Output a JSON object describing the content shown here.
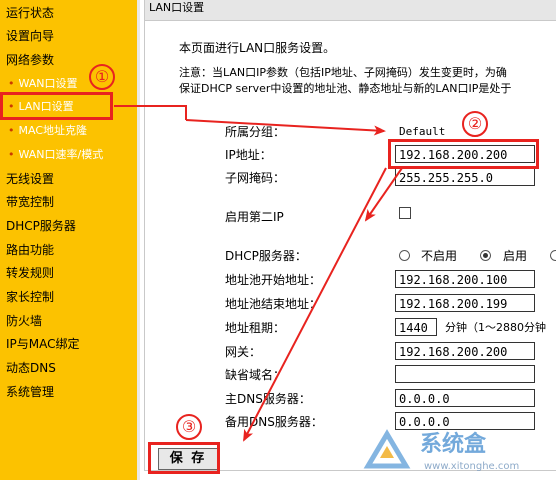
{
  "sidebar": {
    "items": [
      {
        "label": "运行状态",
        "sub": false
      },
      {
        "label": "设置向导",
        "sub": false
      },
      {
        "label": "网络参数",
        "sub": false
      },
      {
        "label": "WAN口设置",
        "sub": true
      },
      {
        "label": "LAN口设置",
        "sub": true
      },
      {
        "label": "MAC地址克隆",
        "sub": true
      },
      {
        "label": "WAN口速率/模式",
        "sub": true
      },
      {
        "label": "无线设置",
        "sub": false
      },
      {
        "label": "带宽控制",
        "sub": false
      },
      {
        "label": "DHCP服务器",
        "sub": false
      },
      {
        "label": "路由功能",
        "sub": false
      },
      {
        "label": "转发规则",
        "sub": false
      },
      {
        "label": "家长控制",
        "sub": false
      },
      {
        "label": "防火墙",
        "sub": false
      },
      {
        "label": "IP与MAC绑定",
        "sub": false
      },
      {
        "label": "动态DNS",
        "sub": false
      },
      {
        "label": "系统管理",
        "sub": false
      }
    ]
  },
  "page": {
    "header": "LAN口设置",
    "intro": "本页面进行LAN口服务设置。",
    "note_line1": "注意：当LAN口IP参数（包括IP地址、子网掩码）发生变更时，为确",
    "note_line2": "保证DHCP server中设置的地址池、静态地址与新的LAN口IP是处于"
  },
  "form": {
    "group_label": "所属分组：",
    "group_value": "Default",
    "ip_label": "IP地址：",
    "ip_value": "192.168.200.200",
    "mask_label": "子网掩码：",
    "mask_value": "255.255.255.0",
    "second_ip_label": "启用第二IP",
    "dhcp_label": "DHCP服务器：",
    "dhcp_off": "不启用",
    "dhcp_on": "启用",
    "pool_start_label": "地址池开始地址：",
    "pool_start_value": "192.168.200.100",
    "pool_end_label": "地址池结束地址：",
    "pool_end_value": "192.168.200.199",
    "lease_label": "地址租期：",
    "lease_value": "1440",
    "lease_unit": "分钟（1～2880分钟",
    "gateway_label": "网关：",
    "gateway_value": "192.168.200.200",
    "domain_label": "缺省域名：",
    "domain_value": "",
    "dns1_label": "主DNS服务器：",
    "dns1_value": "0.0.0.0",
    "dns2_label": "备用DNS服务器：",
    "dns2_value": "0.0.0.0",
    "save_label": "保 存"
  },
  "annotations": {
    "step1": "①",
    "step2": "②",
    "step3": "③",
    "color": "#e8231f"
  },
  "watermark": {
    "brand": "系统盒",
    "url": "www.xitonghe.com"
  }
}
